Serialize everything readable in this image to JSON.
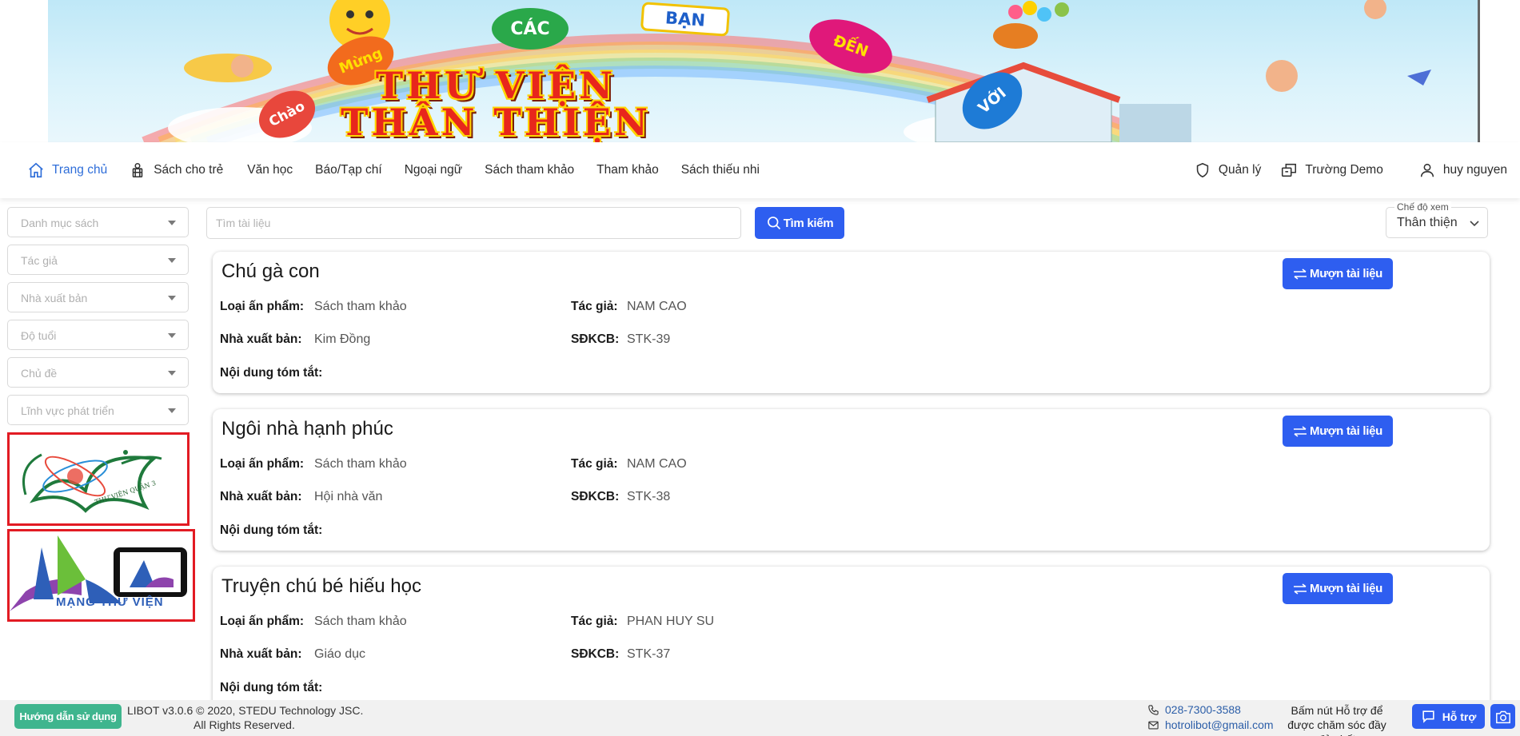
{
  "banner": {
    "words": [
      "Chào",
      "Mừng",
      "CÁC",
      "BẠN",
      "ĐẾN",
      "VỚI"
    ],
    "title_line1": "THƯ VIỆN",
    "title_line2": "THÂN THIỆN"
  },
  "nav": {
    "left_items": [
      {
        "label": "Trang chủ",
        "icon": "home-icon",
        "active": true
      },
      {
        "label": "Sách cho trẻ",
        "icon": "child-icon"
      },
      {
        "label": "Văn học"
      },
      {
        "label": "Báo/Tạp chí"
      },
      {
        "label": "Ngoại ngữ"
      },
      {
        "label": "Sách tham khảo"
      },
      {
        "label": "Tham khảo"
      },
      {
        "label": "Sách thiếu nhi"
      }
    ],
    "right_items": [
      {
        "label": "Quản lý",
        "icon": "shield-icon"
      },
      {
        "label": "Trường Demo",
        "icon": "switch-school-icon"
      },
      {
        "label": "huy nguyen",
        "icon": "user-icon"
      }
    ],
    "active_color": "#2f6ed9"
  },
  "sidebar": {
    "filters": [
      "Danh mục sách",
      "Tác giả",
      "Nhà xuất bản",
      "Độ tuổi",
      "Chủ đề",
      "Lĩnh vực phát triển"
    ],
    "logo1_text": "THƯ VIỆN QUẬN 3",
    "logo2_text": "MẠNG THƯ VIỆN"
  },
  "search": {
    "placeholder": "Tìm tài liệu",
    "button_label": "Tìm kiếm"
  },
  "view_mode": {
    "label": "Chế độ xem",
    "value": "Thân thiện"
  },
  "labels": {
    "type": "Loại ấn phẩm:",
    "author": "Tác giả:",
    "publisher": "Nhà xuất bản:",
    "code": "SĐKCB:",
    "summary": "Nội dung tóm tắt:",
    "borrow": "Mượn tài liệu"
  },
  "books": [
    {
      "title": "Chú gà con",
      "type": "Sách tham khảo",
      "author": "NAM CAO",
      "publisher": "Kim Đồng",
      "code": "STK-39"
    },
    {
      "title": "Ngôi nhà hạnh phúc",
      "type": "Sách tham khảo",
      "author": "NAM CAO",
      "publisher": "Hội nhà văn",
      "code": "STK-38"
    },
    {
      "title": "Truyện chú bé hiếu học",
      "type": "Sách tham khảo",
      "author": "PHAN HUY SU",
      "publisher": "Giáo dục",
      "code": "STK-37"
    }
  ],
  "footer": {
    "guide_label": "Hướng dẫn sử dụng",
    "copyright_line1": "LIBOT v3.0.6 © 2020, STEDU Technology JSC.",
    "copyright_line2": "All Rights Reserved.",
    "phone": "028-7300-3588",
    "email": "hotrolibot@gmail.com",
    "support_text": "Bấm nút Hỗ trợ để được chăm sóc đầy đủ nhất",
    "support_label": "Hỗ trợ"
  },
  "colors": {
    "primary": "#2e5ef0",
    "guide": "#3fb58e",
    "logo_border": "#e21b23"
  }
}
